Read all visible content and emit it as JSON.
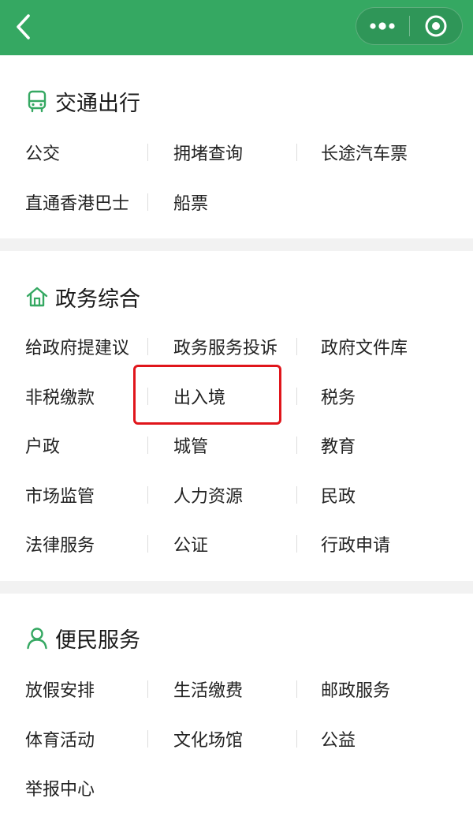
{
  "colors": {
    "topbar": "#35a862",
    "icon_green": "#35a862",
    "highlight_red": "#e0151b"
  },
  "topbar": {
    "back_icon": "chevron-left-icon",
    "more_icon": "more-dots-icon",
    "close_icon": "target-circle-icon"
  },
  "sections": [
    {
      "title": "交通出行",
      "icon": "bus-icon",
      "rows": [
        [
          "公交",
          "拥堵查询",
          "长途汽车票"
        ],
        [
          "直通香港巴士",
          "船票"
        ]
      ]
    },
    {
      "title": "政务综合",
      "icon": "home-icon",
      "rows": [
        [
          "给政府提建议",
          "政务服务投诉",
          "政府文件库"
        ],
        [
          "非税缴款",
          "出入境",
          "税务"
        ],
        [
          "户政",
          "城管",
          "教育"
        ],
        [
          "市场监管",
          "人力资源",
          "民政"
        ],
        [
          "法律服务",
          "公证",
          "行政申请"
        ]
      ]
    },
    {
      "title": "便民服务",
      "icon": "user-icon",
      "rows": [
        [
          "放假安排",
          "生活缴费",
          "邮政服务"
        ],
        [
          "体育活动",
          "文化场馆",
          "公益"
        ],
        [
          "举报中心"
        ]
      ]
    }
  ]
}
